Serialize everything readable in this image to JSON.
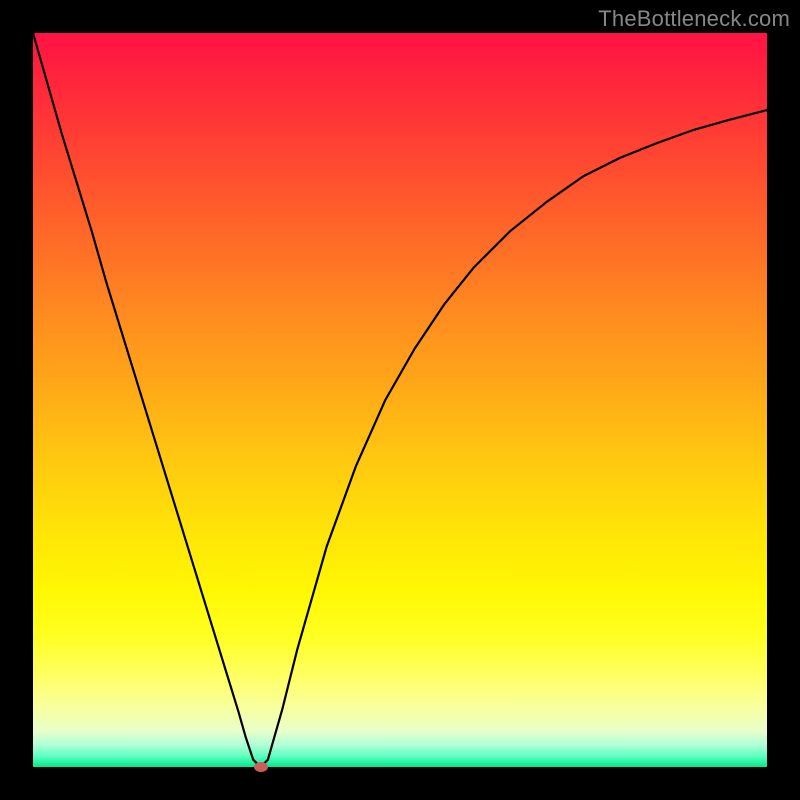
{
  "watermark": "TheBottleneck.com",
  "colors": {
    "frame_bg": "#000000",
    "dot": "#cd5c5c",
    "curve": "#000000",
    "watermark": "#878787"
  },
  "chart_data": {
    "type": "line",
    "title": "",
    "xlabel": "",
    "ylabel": "",
    "xlim": [
      0,
      100
    ],
    "ylim": [
      0,
      100
    ],
    "grid": false,
    "legend": false,
    "series": [
      {
        "name": "bottleneck-curve",
        "x": [
          0,
          2,
          4,
          6,
          8,
          10,
          12,
          14,
          16,
          18,
          20,
          22,
          24,
          26,
          28,
          29,
          30,
          31,
          32,
          34,
          36,
          38,
          40,
          44,
          48,
          52,
          56,
          60,
          65,
          70,
          75,
          80,
          85,
          90,
          95,
          100
        ],
        "values": [
          100,
          93,
          86,
          79.5,
          73,
          66,
          59.5,
          53,
          46.5,
          40,
          33.5,
          27,
          20.5,
          14,
          7.5,
          4,
          1,
          0,
          1,
          8,
          16,
          23,
          30,
          41,
          50,
          57,
          63,
          68,
          73,
          77,
          80.5,
          83,
          85,
          86.8,
          88.2,
          89.5
        ]
      }
    ],
    "marker": {
      "x": 31,
      "y": 0
    }
  }
}
